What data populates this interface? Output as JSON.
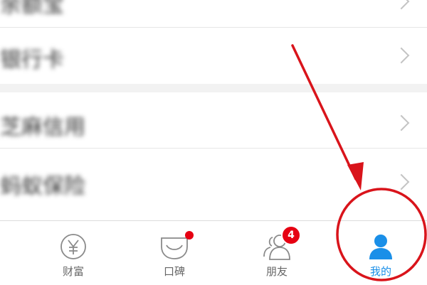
{
  "list": {
    "items": [
      {
        "label": "余额宝",
        "icon": "chevron-right-icon"
      },
      {
        "label": "银行卡",
        "icon": "chevron-right-icon"
      },
      {
        "label": "芝麻信用",
        "icon": "chevron-right-icon"
      },
      {
        "label": "蚂蚁保险",
        "icon": "chevron-right-icon"
      }
    ]
  },
  "tabbar": {
    "tabs": [
      {
        "label": "财富",
        "icon": "yen-circle-icon"
      },
      {
        "label": "口碑",
        "icon": "koubei-smile-icon",
        "badge": "dot"
      },
      {
        "label": "朋友",
        "icon": "friends-icon",
        "badge_count": "4"
      },
      {
        "label": "我的",
        "icon": "user-icon",
        "active": true
      }
    ]
  },
  "colors": {
    "accent": "#1a8fe8",
    "badge": "#e60012",
    "annotation": "#d9141b"
  }
}
